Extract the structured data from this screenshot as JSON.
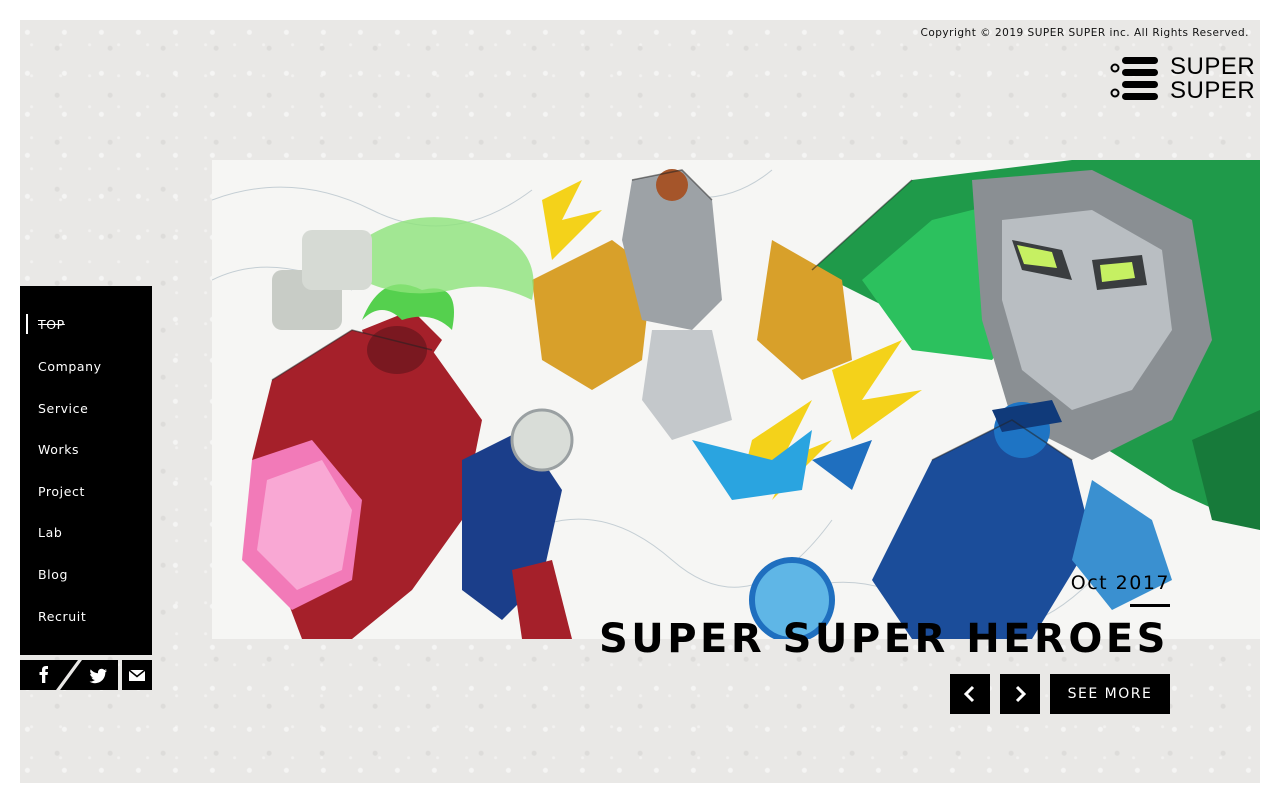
{
  "header": {
    "copyright": "Copyright © 2019 SUPER SUPER inc. All Rights Reserved.",
    "logo_line1": "SUPER",
    "logo_line2": "SUPER"
  },
  "nav": {
    "items": [
      {
        "label": "TOP"
      },
      {
        "label": "Company"
      },
      {
        "label": "Service"
      },
      {
        "label": "Works"
      },
      {
        "label": "Project"
      },
      {
        "label": "Lab"
      },
      {
        "label": "Blog"
      },
      {
        "label": "Recruit"
      }
    ],
    "active_index": 0
  },
  "social": {
    "icons": [
      "facebook-icon",
      "twitter-icon",
      "mail-icon"
    ]
  },
  "slide": {
    "date": "Oct 2017",
    "title": "SUPER SUPER HEROES",
    "see_more_label": "SEE MORE",
    "prev_icon": "chevron-left-icon",
    "next_icon": "chevron-right-icon"
  },
  "colors": {
    "background": "#e9e8e6",
    "nav_background": "#000000",
    "text": "#000000",
    "accent_green": "#1f9a4a",
    "accent_red": "#a5202a"
  }
}
